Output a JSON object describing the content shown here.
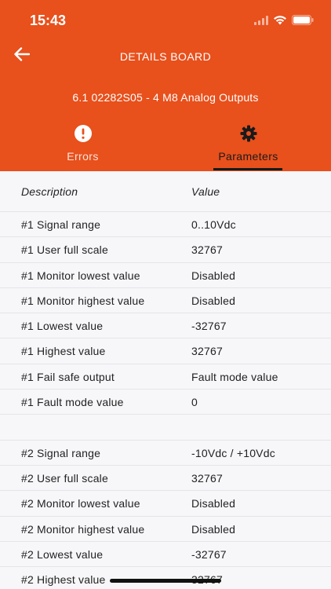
{
  "status": {
    "time": "15:43"
  },
  "nav": {
    "title": "DETAILS BOARD"
  },
  "board": {
    "subtitle": "6.1 02282S05 - 4 M8 Analog Outputs"
  },
  "tabs": [
    {
      "label": "Errors",
      "icon": "alert-circle-icon",
      "active": false
    },
    {
      "label": "Parameters",
      "icon": "gear-icon",
      "active": true
    }
  ],
  "table": {
    "header": {
      "description": "Description",
      "value": "Value"
    },
    "rows": [
      {
        "description": "#1 Signal range",
        "value": "0..10Vdc"
      },
      {
        "description": "#1 User full scale",
        "value": "32767"
      },
      {
        "description": "#1 Monitor lowest value",
        "value": "Disabled"
      },
      {
        "description": "#1 Monitor highest value",
        "value": "Disabled"
      },
      {
        "description": "#1 Lowest value",
        "value": "-32767"
      },
      {
        "description": "#1 Highest value",
        "value": "32767"
      },
      {
        "description": "#1 Fail safe output",
        "value": "Fault mode value"
      },
      {
        "description": "#1 Fault mode value",
        "value": "0"
      },
      {
        "description": "",
        "value": ""
      },
      {
        "description": "#2 Signal range",
        "value": "-10Vdc / +10Vdc"
      },
      {
        "description": "#2 User full scale",
        "value": "32767"
      },
      {
        "description": "#2 Monitor lowest value",
        "value": "Disabled"
      },
      {
        "description": "#2 Monitor highest value",
        "value": "Disabled"
      },
      {
        "description": "#2 Lowest value",
        "value": "-32767"
      },
      {
        "description": "#2 Highest value",
        "value": "32767"
      }
    ]
  },
  "colors": {
    "accent": "#e8501c",
    "background": "#f7f6f9"
  }
}
